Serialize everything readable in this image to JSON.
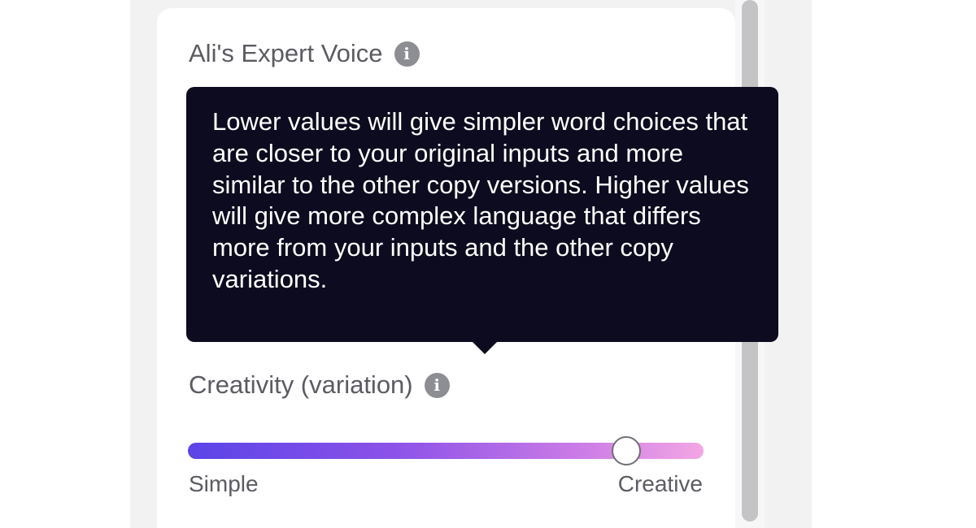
{
  "voice_section": {
    "label": "Ali's Expert Voice",
    "info_icon_glyph": "i"
  },
  "tooltip": {
    "text": "Lower values will give simpler word choices that are closer to your original inputs and more similar to the other copy versions. Higher values will give more complex language that differs more from your inputs and the other copy variations."
  },
  "creativity_section": {
    "label": "Creativity (variation)",
    "info_icon_glyph": "i",
    "slider": {
      "value_fraction": 0.85,
      "min_label": "Simple",
      "max_label": "Creative"
    }
  },
  "colors": {
    "tooltip_bg": "#0d0b1f",
    "slider_start": "#5b44e8",
    "slider_end": "#f3a6e4",
    "text_gray": "#5b5b62"
  }
}
